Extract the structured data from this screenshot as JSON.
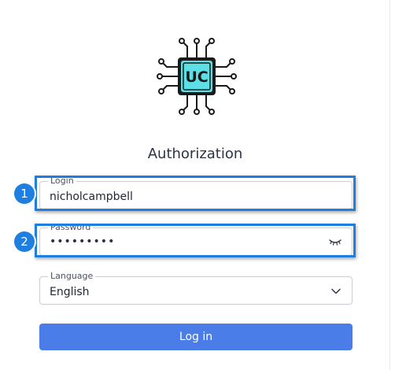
{
  "logo": {
    "text": "UC",
    "accent": "#5ce0e6",
    "stroke": "#1a1a1a"
  },
  "title": "Authorization",
  "login": {
    "label": "Login",
    "value": "nicholcampbell"
  },
  "password": {
    "label": "Password",
    "value": "•••••••••",
    "toggle_icon": "eye-closed-icon"
  },
  "language": {
    "label": "Language",
    "value": "English",
    "icon": "chevron-down-icon"
  },
  "submit": {
    "label": "Log in"
  },
  "annotations": [
    {
      "number": "1",
      "target": "login-field"
    },
    {
      "number": "2",
      "target": "password-field"
    }
  ],
  "colors": {
    "highlight": "#1f7fe0",
    "button": "#4a7de8"
  }
}
